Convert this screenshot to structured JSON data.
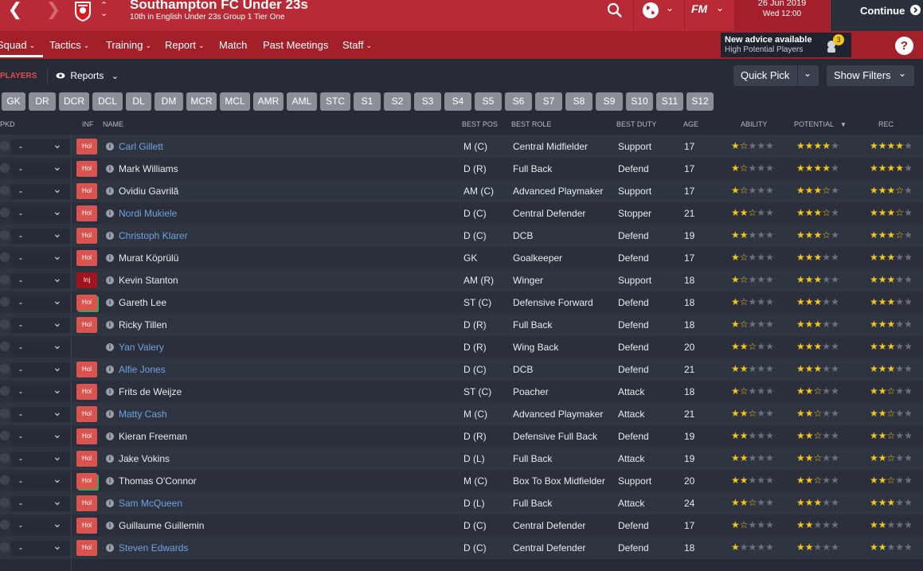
{
  "header": {
    "club_name": "Southampton FC Under 23s",
    "club_subtitle": "10th in English Under 23s Group 1 Tier One",
    "date_line1": "26 Jun 2019",
    "date_line2": "Wed 12:00",
    "continue_label": "Continue",
    "fm_label": "FM"
  },
  "menu": {
    "items": [
      {
        "label": "Squad"
      },
      {
        "label": "Tactics"
      },
      {
        "label": "Training"
      },
      {
        "label": "Report"
      },
      {
        "label": "Match"
      },
      {
        "label": "Past Meetings"
      },
      {
        "label": "Staff"
      }
    ],
    "advice_title": "New advice available",
    "advice_sub": "High Potential Players",
    "advice_count": "3",
    "help_label": "?"
  },
  "subbar": {
    "players_tab": "PLAYERS",
    "reports_label": "Reports",
    "quick_pick": "Quick Pick",
    "show_filters": "Show Filters"
  },
  "positions": [
    "GK",
    "DR",
    "DCR",
    "DCL",
    "DL",
    "DM",
    "MCR",
    "MCL",
    "AMR",
    "AML",
    "STC",
    "S1",
    "S2",
    "S3",
    "S4",
    "S5",
    "S6",
    "S7",
    "S8",
    "S9",
    "S10",
    "S11",
    "S12"
  ],
  "columns": {
    "pkd": "PKD",
    "inf": "INF",
    "name": "NAME",
    "best_pos": "BEST POS",
    "best_role": "BEST ROLE",
    "best_duty": "BEST DUTY",
    "age": "AGE",
    "ability": "ABILITY",
    "potential": "POTENTIAL",
    "rec": "REC"
  },
  "players": [
    {
      "pick": "-",
      "inf": "Hol",
      "inf_type": "hol",
      "name": "Carl Gillett",
      "link": true,
      "pos": "M (C)",
      "role": "Central Midfielder",
      "duty": "Support",
      "age": "17",
      "ability": 1.5,
      "potential": 4,
      "rec": 4
    },
    {
      "pick": "-",
      "inf": "Hol",
      "inf_type": "hol",
      "name": "Mark Williams",
      "link": false,
      "pos": "D (R)",
      "role": "Full Back",
      "duty": "Defend",
      "age": "17",
      "ability": 1.5,
      "potential": 4,
      "rec": 4
    },
    {
      "pick": "-",
      "inf": "Hol",
      "inf_type": "hol",
      "name": "Ovidiu Gavrilă",
      "link": false,
      "pos": "AM (C)",
      "role": "Advanced Playmaker",
      "duty": "Support",
      "age": "17",
      "ability": 1.5,
      "potential": 3.5,
      "rec": 3.5
    },
    {
      "pick": "-",
      "inf": "Hol",
      "inf_type": "hol",
      "name": "Nordi Mukiele",
      "link": true,
      "pos": "D (C)",
      "role": "Central Defender",
      "duty": "Stopper",
      "age": "21",
      "ability": 2.5,
      "potential": 3.5,
      "rec": 3.5
    },
    {
      "pick": "-",
      "inf": "Hol",
      "inf_type": "hol",
      "name": "Christoph Klarer",
      "link": true,
      "pos": "D (C)",
      "role": "DCB",
      "duty": "Defend",
      "age": "19",
      "ability": 2,
      "potential": 3.5,
      "rec": 3.5
    },
    {
      "pick": "-",
      "inf": "Hol",
      "inf_type": "hol",
      "name": "Murat Köprülü",
      "link": false,
      "pos": "GK",
      "role": "Goalkeeper",
      "duty": "Defend",
      "age": "17",
      "ability": 1.5,
      "potential": 3,
      "rec": 3
    },
    {
      "pick": "-",
      "inf": "Inj",
      "inf_type": "inj",
      "name": "Kevin Stanton",
      "link": false,
      "pos": "AM (R)",
      "role": "Winger",
      "duty": "Support",
      "age": "18",
      "ability": 1.5,
      "potential": 3,
      "rec": 3
    },
    {
      "pick": "-",
      "inf": "Hol",
      "inf_type": "green",
      "name": "Gareth Lee",
      "link": false,
      "pos": "ST (C)",
      "role": "Defensive Forward",
      "duty": "Defend",
      "age": "18",
      "ability": 1.5,
      "potential": 3,
      "rec": 3
    },
    {
      "pick": "-",
      "inf": "Hol",
      "inf_type": "hol",
      "name": "Ricky Tillen",
      "link": false,
      "pos": "D (R)",
      "role": "Full Back",
      "duty": "Defend",
      "age": "18",
      "ability": 1.5,
      "potential": 3,
      "rec": 3
    },
    {
      "pick": "-",
      "inf": "",
      "inf_type": "none",
      "name": "Yan Valery",
      "link": true,
      "pos": "D (R)",
      "role": "Wing Back",
      "duty": "Defend",
      "age": "20",
      "ability": 2.5,
      "potential": 3,
      "rec": 3
    },
    {
      "pick": "-",
      "inf": "Hol",
      "inf_type": "hol",
      "name": "Alfie Jones",
      "link": true,
      "pos": "D (C)",
      "role": "DCB",
      "duty": "Defend",
      "age": "21",
      "ability": 2,
      "potential": 3,
      "rec": 3
    },
    {
      "pick": "-",
      "inf": "Hol",
      "inf_type": "hol",
      "name": "Frits de Weijze",
      "link": false,
      "pos": "ST (C)",
      "role": "Poacher",
      "duty": "Attack",
      "age": "18",
      "ability": 1.5,
      "potential": 2.5,
      "rec": 2.5
    },
    {
      "pick": "-",
      "inf": "Hol",
      "inf_type": "hol",
      "name": "Matty Cash",
      "link": true,
      "pos": "M (C)",
      "role": "Advanced Playmaker",
      "duty": "Attack",
      "age": "21",
      "ability": 2.5,
      "potential": 2.5,
      "rec": 2.5
    },
    {
      "pick": "-",
      "inf": "Hol",
      "inf_type": "hol",
      "name": "Kieran Freeman",
      "link": false,
      "pos": "D (R)",
      "role": "Defensive Full Back",
      "duty": "Defend",
      "age": "19",
      "ability": 2,
      "potential": 2.5,
      "rec": 2.5
    },
    {
      "pick": "-",
      "inf": "Hol",
      "inf_type": "hol",
      "name": "Jake Vokins",
      "link": false,
      "pos": "D (L)",
      "role": "Full Back",
      "duty": "Attack",
      "age": "19",
      "ability": 2,
      "potential": 2.5,
      "rec": 2.5
    },
    {
      "pick": "-",
      "inf": "Hol",
      "inf_type": "green",
      "name": "Thomas O'Connor",
      "link": false,
      "pos": "M (C)",
      "role": "Box To Box Midfielder",
      "duty": "Support",
      "age": "20",
      "ability": 2,
      "potential": 2.5,
      "rec": 2.5
    },
    {
      "pick": "-",
      "inf": "Hol",
      "inf_type": "hol",
      "name": "Sam McQueen",
      "link": true,
      "pos": "D (L)",
      "role": "Full Back",
      "duty": "Attack",
      "age": "24",
      "ability": 2.5,
      "potential": 3,
      "rec": 3
    },
    {
      "pick": "-",
      "inf": "Hol",
      "inf_type": "hol",
      "name": "Guillaume Guillemin",
      "link": false,
      "pos": "D (C)",
      "role": "Central Defender",
      "duty": "Defend",
      "age": "17",
      "ability": 1.5,
      "potential": 2,
      "rec": 2
    },
    {
      "pick": "-",
      "inf": "Hol",
      "inf_type": "hol",
      "name": "Steven Edwards",
      "link": true,
      "pos": "D (C)",
      "role": "Central Defender",
      "duty": "Defend",
      "age": "18",
      "ability": 1,
      "potential": 2,
      "rec": 2
    }
  ],
  "colors": {
    "brand_red": "#b82a35",
    "menu_red": "#a3202b",
    "link_blue": "#6fa3e0",
    "star_gold": "#f5c518"
  },
  "icons": [
    "back-arrow-icon",
    "forward-arrow-icon",
    "club-crest-icon",
    "collapse-icon",
    "search-icon",
    "globe-icon",
    "chevron-down-icon",
    "eye-icon",
    "info-icon",
    "tick-icon",
    "advice-icon"
  ]
}
